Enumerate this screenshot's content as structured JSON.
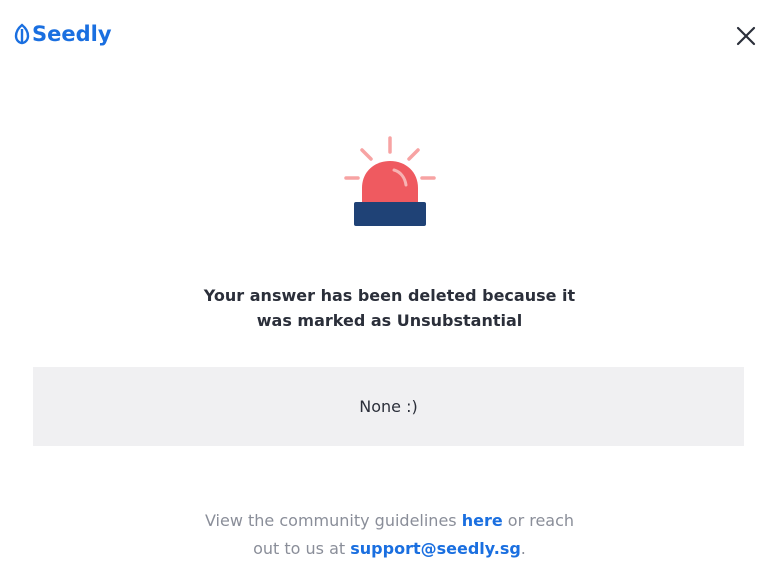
{
  "brand": {
    "name": "Seedly",
    "color": "#1a6fe0"
  },
  "header": {
    "close_icon": "close-icon"
  },
  "illustration": {
    "icon": "siren-icon",
    "colors": {
      "light": "#ef5a60",
      "rays": "#f7a3a3",
      "base": "#1f4276"
    }
  },
  "notice": {
    "line1": "Your answer has been deleted because it",
    "line2": "was marked as Unsubstantial"
  },
  "reason": {
    "text": "None :)"
  },
  "footer": {
    "prefix": "View the community guidelines ",
    "link_here": "here",
    "middle_1": " or reach",
    "middle_2": "out to us at ",
    "email": "support@seedly.sg",
    "suffix": "."
  }
}
